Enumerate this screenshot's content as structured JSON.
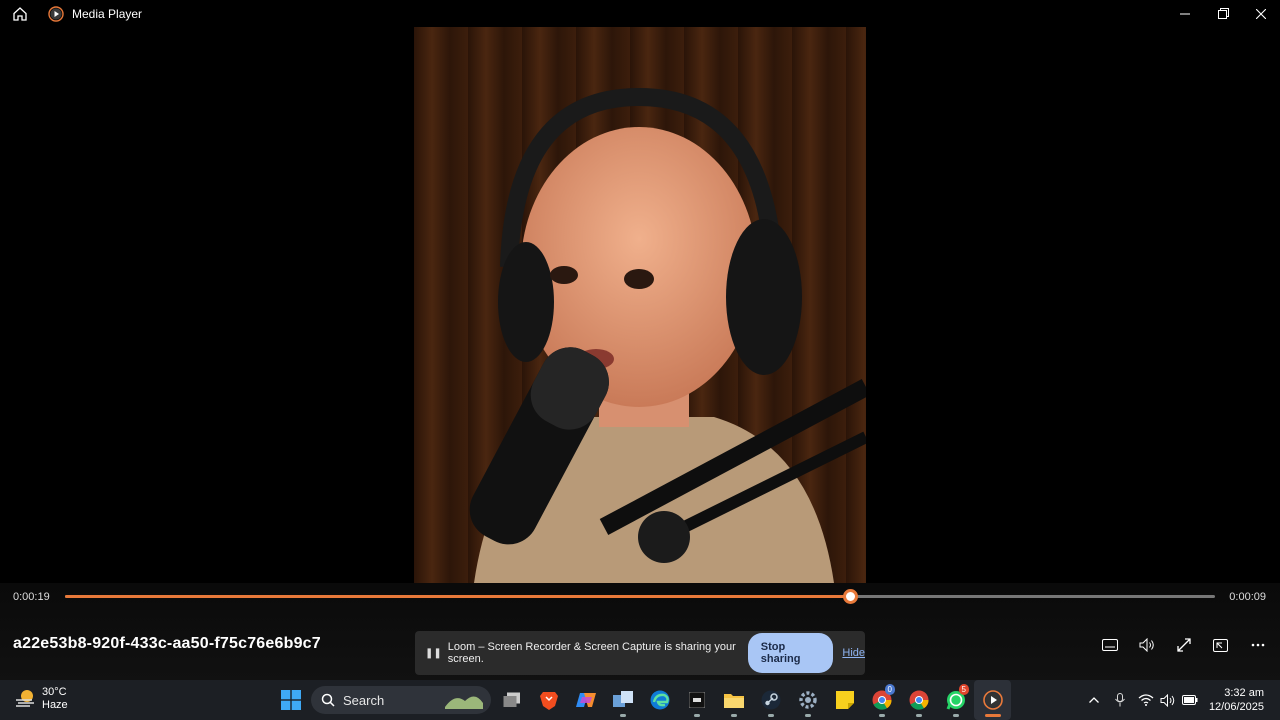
{
  "window": {
    "app_title": "Media Player"
  },
  "player": {
    "elapsed": "0:00:19",
    "remaining": "0:00:09",
    "progress_fraction": 0.683,
    "file_title": "a22e53b8-920f-433c-aa50-f75c76e6b9c7",
    "accent_color": "#e8793a"
  },
  "loom": {
    "message": "Loom – Screen Recorder & Screen Capture is sharing your screen.",
    "stop_label": "Stop sharing",
    "hide_label": "Hide"
  },
  "taskbar": {
    "weather": {
      "temp": "30°C",
      "condition": "Haze"
    },
    "search_label": "Search",
    "whatsapp_badge": "5",
    "chrome_badge": "0",
    "clock": {
      "time": "3:32 am",
      "date": "12/06/2025"
    }
  },
  "icons": [
    "home-icon",
    "media-player-icon",
    "minimize-icon",
    "maximize-icon",
    "close-icon",
    "subtitles-icon",
    "volume-icon",
    "fullscreen-icon",
    "miniplayer-icon",
    "more-icon",
    "windows-start-icon",
    "search-icon",
    "task-view-icon",
    "brave-icon",
    "copilot-icon",
    "edge-icon",
    "file-explorer-icon",
    "steam-icon",
    "settings-icon",
    "sticky-notes-icon",
    "chrome-icon",
    "whatsapp-icon",
    "wifi-icon",
    "microphone-icon",
    "battery-icon"
  ]
}
